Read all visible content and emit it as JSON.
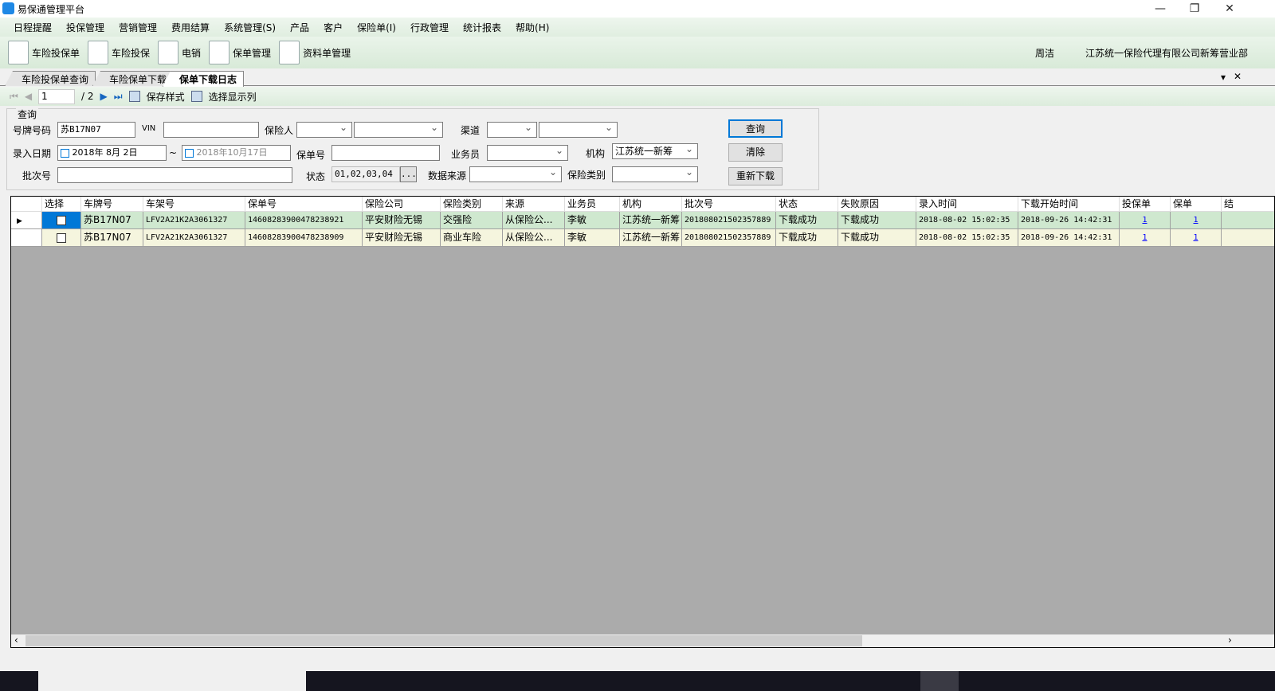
{
  "window": {
    "title": "易保通管理平台",
    "minimize": "—",
    "restore": "❐",
    "close": "✕"
  },
  "menu": [
    "日程提醒",
    "投保管理",
    "营销管理",
    "费用结算",
    "系统管理(S)",
    "产品",
    "客户",
    "保险单(I)",
    "行政管理",
    "统计报表",
    "帮助(H)"
  ],
  "toolbar": {
    "items": [
      "车险投保单",
      "车险投保",
      "电销",
      "保单管理",
      "资料单管理"
    ],
    "user": "周洁",
    "org": "江苏统一保险代理有限公司新筹营业部"
  },
  "tabs": [
    "车险投保单查询",
    "车险保单下载",
    "保单下载日志"
  ],
  "tab_controls": {
    "dropdown": "▾",
    "close": "✕"
  },
  "pager": {
    "page": "1",
    "total": "/ 2",
    "save_style": "保存样式",
    "choose_columns": "选择显示列"
  },
  "query": {
    "legend": "查询",
    "plate_label": "号牌号码",
    "plate": "苏B17N07",
    "vin_label": "VIN",
    "vin": "",
    "insurer_label": "保险人",
    "channel_label": "渠道",
    "date_label": "录入日期",
    "date_from": "2018年 8月 2日",
    "date_sep": "~",
    "date_to": "2018年10月17日",
    "policy_label": "保单号",
    "salesman_label": "业务员",
    "org_label": "机构",
    "org": "江苏统一新筹",
    "batch_label": "批次号",
    "status_label": "状态",
    "status": "01,02,03,04",
    "status_btn": "...",
    "source_label": "数据来源",
    "type_label": "保险类别",
    "search": "查询",
    "clear": "清除",
    "redownload": "重新下载"
  },
  "grid": {
    "columns": [
      "选择",
      "车牌号",
      "车架号",
      "保单号",
      "保险公司",
      "保险类别",
      "来源",
      "业务员",
      "机构",
      "批次号",
      "状态",
      "失败原因",
      "录入时间",
      "下载开始时间",
      "投保单",
      "保单",
      "结"
    ],
    "rows": [
      [
        "",
        "苏B17N07",
        "LFV2A21K2A3061327",
        "14608283900478238921",
        "平安财险无锡",
        "交强险",
        "从保险公...",
        "李敏",
        "江苏统一新筹",
        "201808021502357889",
        "下载成功",
        "下载成功",
        "2018-08-02 15:02:35",
        "2018-09-26 14:42:31",
        "1",
        "1",
        ""
      ],
      [
        "",
        "苏B17N07",
        "LFV2A21K2A3061327",
        "14608283900478238909",
        "平安财险无锡",
        "商业车险",
        "从保险公...",
        "李敏",
        "江苏统一新筹",
        "201808021502357889",
        "下载成功",
        "下载成功",
        "2018-08-02 15:02:35",
        "2018-09-26 14:42:31",
        "1",
        "1",
        ""
      ]
    ]
  },
  "colors": {
    "row_selected": "#cfe8cf",
    "row_alt": "#f5f5de",
    "grid_bg": "#ababab",
    "accent": "#0078d7"
  }
}
